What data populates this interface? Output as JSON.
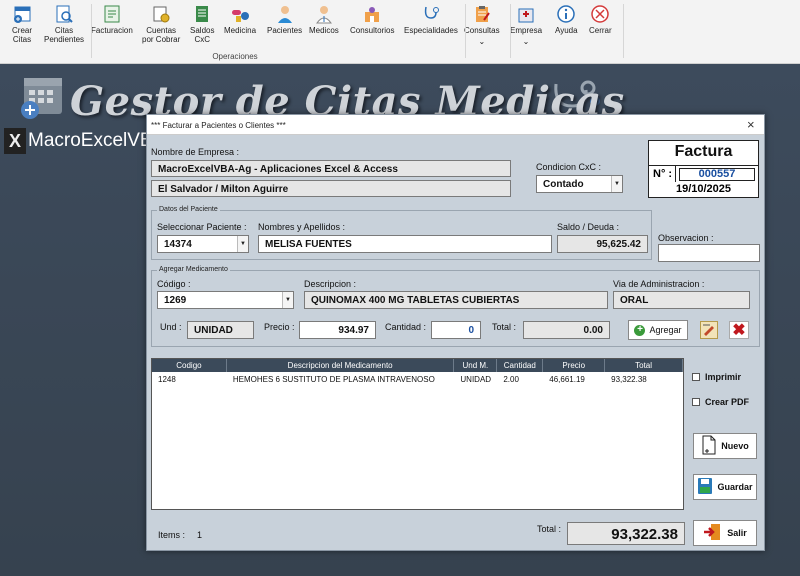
{
  "ribbon": {
    "items": [
      {
        "label": "Crear\nCitas",
        "icon": "calendar-add-icon"
      },
      {
        "label": "Citas\nPendientes",
        "icon": "search-doc-icon"
      },
      {
        "label": "Facturacion",
        "icon": "invoice-icon"
      },
      {
        "label": "Cuentas\npor Cobrar",
        "icon": "coins-icon"
      },
      {
        "label": "Saldos\nCxC",
        "icon": "ledger-icon"
      },
      {
        "label": "Medicina",
        "icon": "pills-icon"
      },
      {
        "label": "Pacientes",
        "icon": "patient-icon"
      },
      {
        "label": "Medicos",
        "icon": "doctor-icon"
      },
      {
        "label": "Consultorios",
        "icon": "office-icon"
      },
      {
        "label": "Especialidades",
        "icon": "stethoscope-icon"
      },
      {
        "label": "Consultas",
        "icon": "clipboard-icon"
      },
      {
        "label": "Empresa",
        "icon": "hospital-icon"
      },
      {
        "label": "Ayuda",
        "icon": "info-icon"
      },
      {
        "label": "Cerrar",
        "icon": "close-circle-icon"
      }
    ],
    "group_label": "Operaciones"
  },
  "app_title": "Gestor de Citas Medicas",
  "brand": "MacroExcelVBA",
  "dialog": {
    "title": "*** Facturar a Pacientes o Clientes ***",
    "close": "×",
    "empresa_label": "Nombre de Empresa :",
    "empresa_name": "MacroExcelVBA-Ag - Aplicaciones Excel & Access",
    "empresa_addr": "El Salvador / Milton Aguirre",
    "condicion_label": "Condicion CxC :",
    "condicion_value": "Contado",
    "factura": {
      "title": "Factura",
      "no_label": "N° :",
      "number": "000557",
      "date": "19/10/2025"
    },
    "paciente": {
      "frame_label": "Datos del Paciente",
      "select_label": "Seleccionar Paciente :",
      "select_value": "14374",
      "name_label": "Nombres y Apellidos :",
      "name_value": "MELISA FUENTES",
      "saldo_label": "Saldo / Deuda :",
      "saldo_value": "95,625.42"
    },
    "observacion_label": "Observacion :",
    "observacion_value": "",
    "medicamento": {
      "frame_label": "Agregar Medicamento",
      "codigo_label": "Código :",
      "codigo_value": "1269",
      "desc_label": "Descripcion :",
      "desc_value": "QUINOMAX 400 MG TABLETAS CUBIERTAS",
      "via_label": "Via de Administracion :",
      "via_value": "ORAL",
      "und_label": "Und :",
      "und_value": "UNIDAD",
      "precio_label": "Precio :",
      "precio_value": "934.97",
      "cantidad_label": "Cantidad :",
      "cantidad_value": "0",
      "total_label": "Total :",
      "total_value": "0.00",
      "agregar": "Agregar"
    },
    "grid": {
      "headers": [
        "Codigo",
        "Descripcion del Medicamento",
        "Und M.",
        "Cantidad",
        "Precio",
        "Total"
      ],
      "rows": [
        [
          "1248",
          "HEMOHES 6  SUSTITUTO DE PLASMA INTRAVENOSO",
          "UNIDAD",
          "2.00",
          "46,661.19",
          "93,322.38"
        ]
      ]
    },
    "imprimir": "Imprimir",
    "crear_pdf": "Crear PDF",
    "nuevo": "Nuevo",
    "guardar": "Guardar",
    "salir": "Salir",
    "items_label": "Items :",
    "items_value": "1",
    "total_label": "Total :",
    "total_value": "93,322.38"
  },
  "colors": {
    "accent": "#1a4fa0",
    "grid_header": "#3b4a5a",
    "dialog_bg": "#c8d1da"
  }
}
